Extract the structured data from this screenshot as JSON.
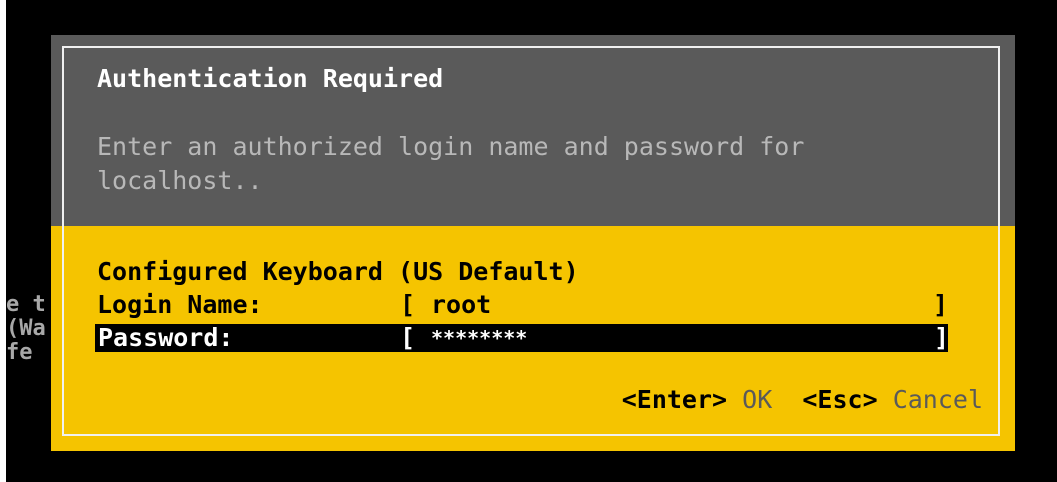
{
  "dialog": {
    "title": "Authentication Required",
    "message": "Enter an authorized login name and password for\nlocalhost..",
    "keyboard_label": "Configured Keyboard (US Default)",
    "login": {
      "label": "Login Name:",
      "open_bracket": "[",
      "value": "root",
      "close_bracket": "]"
    },
    "password": {
      "label": "Password:",
      "open_bracket": "[",
      "value": "********",
      "close_bracket": "]"
    },
    "actions": {
      "ok_key": "<Enter>",
      "ok_label": "OK",
      "cancel_key": "<Esc>",
      "cancel_label": "Cancel"
    }
  },
  "background": {
    "fragments": [
      "e t",
      "(Wa",
      "fe"
    ]
  },
  "colors": {
    "dialog_header": "#5a5a5a",
    "dialog_body": "#f5c400",
    "frame": "#f0f0f0",
    "screen": "#000000"
  }
}
